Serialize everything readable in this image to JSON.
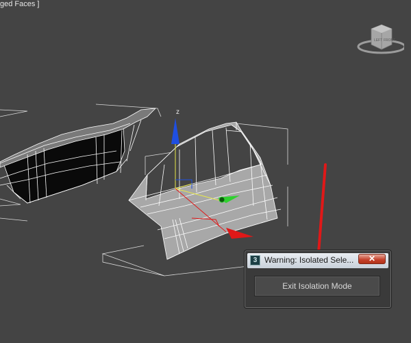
{
  "viewport": {
    "label": "ged Faces ]",
    "background_color": "#444444",
    "wire_color": "#ffffff",
    "gizmo": {
      "z_label": "z",
      "z_axis_color": "#1f4fe0",
      "y_axis_color": "#2fd12f",
      "x_axis_color": "#e01818"
    }
  },
  "viewcube": {
    "face_top": "TOP",
    "face_left": "LEFT",
    "face_front": "FRONT",
    "icon": "viewcube-icon"
  },
  "annotation": {
    "color": "#e01818"
  },
  "dialog": {
    "title": "Warning: Isolated Sele...",
    "app_icon": "3",
    "close_symbol": "✕",
    "button_label": "Exit Isolation Mode"
  }
}
